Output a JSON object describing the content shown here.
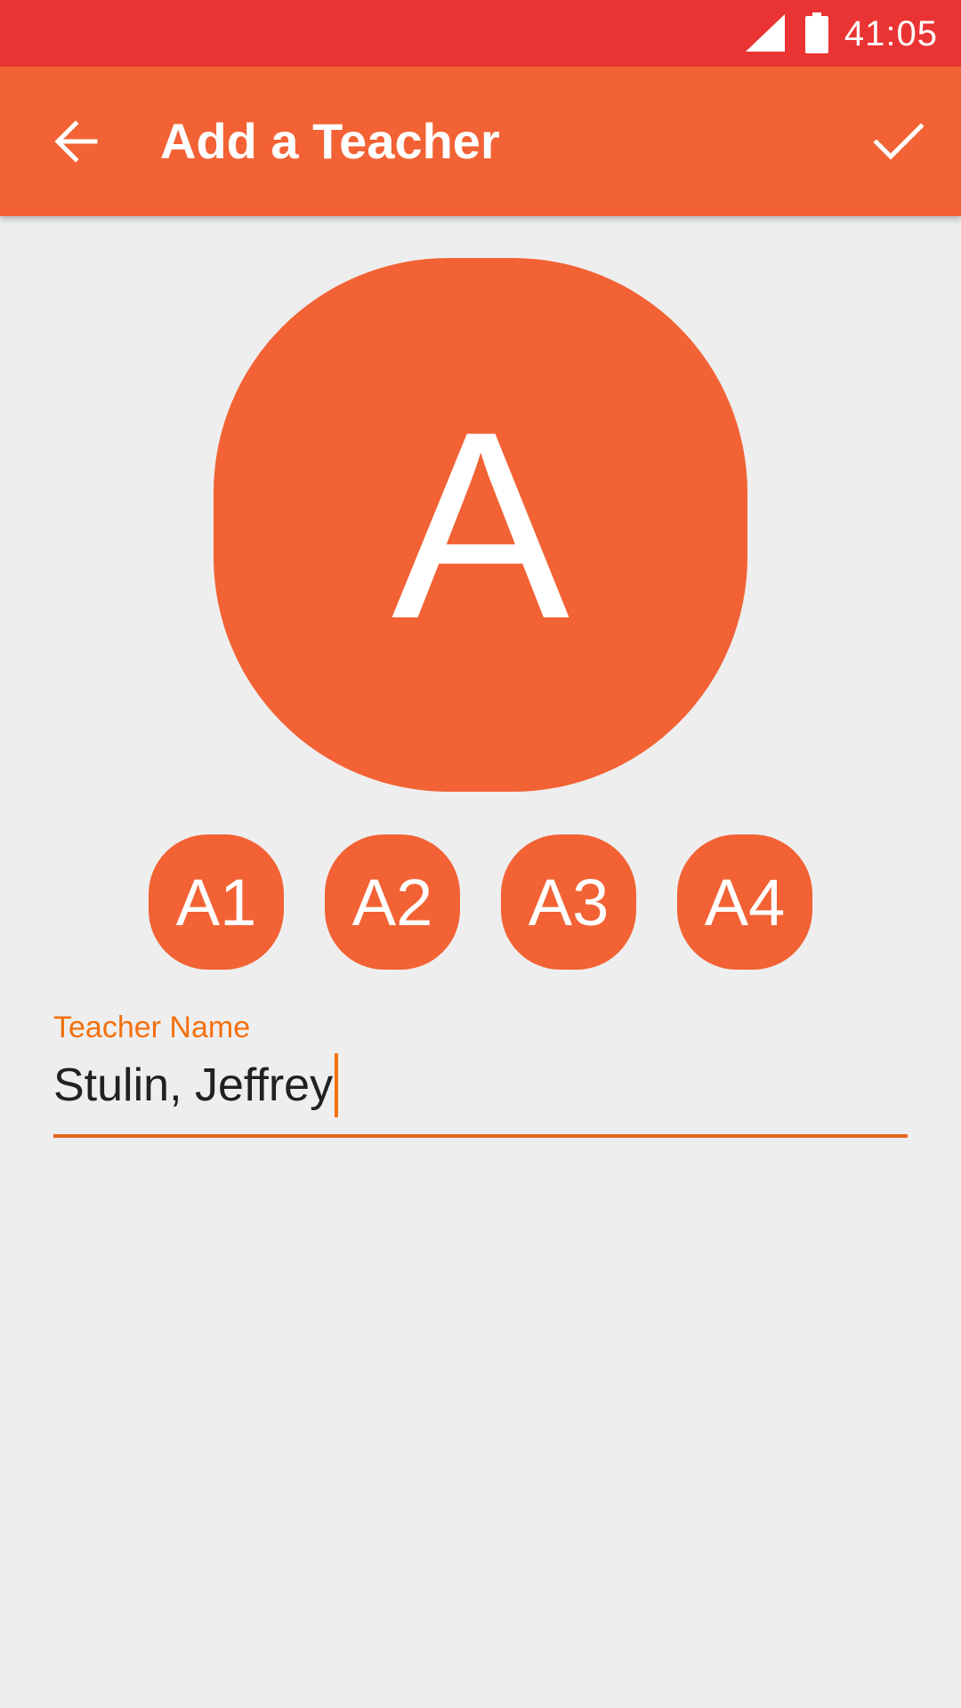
{
  "status_bar": {
    "time": "41:05",
    "bg_color": "#e93433",
    "signal_icon": "cell-signal-icon",
    "battery_icon": "battery-full-icon"
  },
  "app_bar": {
    "title": "Add a Teacher",
    "back_icon": "arrow-back-icon",
    "confirm_icon": "check-icon",
    "bg_color": "#f26234"
  },
  "avatar": {
    "letter": "A",
    "color": "#f26234"
  },
  "variants": [
    {
      "label": "A1"
    },
    {
      "label": "A2"
    },
    {
      "label": "A3"
    },
    {
      "label": "A4"
    }
  ],
  "form": {
    "name_label": "Teacher Name",
    "name_value": "Stulin, Jeffrey",
    "accent_color": "#f5700f"
  }
}
